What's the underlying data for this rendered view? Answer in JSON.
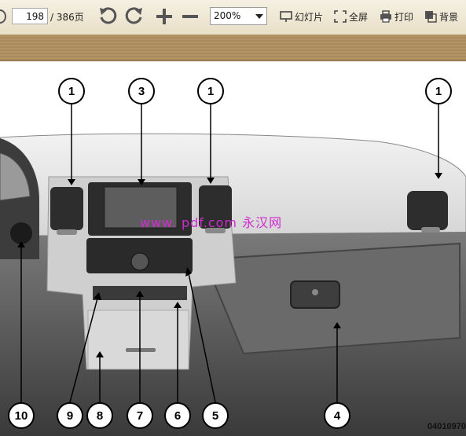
{
  "toolbar": {
    "page_current": "198",
    "page_total": "/ 386页",
    "zoom": "200%",
    "buttons": {
      "slideshow": "幻灯片",
      "fullscreen": "全屏",
      "print": "打印",
      "background": "背景"
    },
    "icons": {
      "rotate_left": "rotate-left-icon",
      "rotate_right": "rotate-right-icon",
      "zoom_in": "zoom-in-icon",
      "zoom_out": "zoom-out-icon"
    }
  },
  "figure": {
    "watermark": "www.  pdf.com 永汉网",
    "code": "04010970",
    "callouts": {
      "c1a": "1",
      "c3": "3",
      "c1b": "1",
      "c1c": "1",
      "c10": "10",
      "c9": "9",
      "c8": "8",
      "c7": "7",
      "c6": "6",
      "c5": "5",
      "c4": "4"
    }
  }
}
